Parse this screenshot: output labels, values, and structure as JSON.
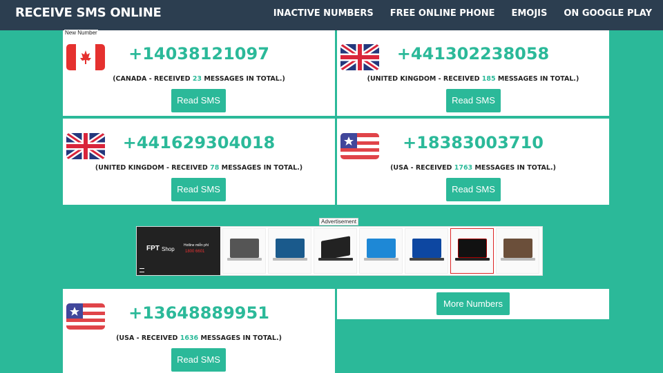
{
  "header": {
    "brand": "RECEIVE SMS ONLINE",
    "nav": [
      "INACTIVE NUMBERS",
      "FREE ONLINE PHONE",
      "EMOJIS",
      "ON GOOGLE PLAY"
    ]
  },
  "new_label": "New Number",
  "cards": [
    {
      "flag": "canada-flag",
      "number": "+14038121097",
      "prefix": "(CANADA - RECEIVED ",
      "count": "23",
      "suffix": " MESSAGES IN TOTAL.)",
      "button": "Read SMS"
    },
    {
      "flag": "uk-flag",
      "number": "+441302238058",
      "prefix": "(UNITED KINGDOM - RECEIVED ",
      "count": "185",
      "suffix": " MESSAGES IN TOTAL.)",
      "button": "Read SMS"
    },
    {
      "flag": "uk-flag",
      "number": "+441629304018",
      "prefix": "(UNITED KINGDOM - RECEIVED ",
      "count": "78",
      "suffix": " MESSAGES IN TOTAL.)",
      "button": "Read SMS"
    },
    {
      "flag": "usa-flag",
      "number": "+18383003710",
      "prefix": "(USA - RECEIVED ",
      "count": "1763",
      "suffix": " MESSAGES IN TOTAL.)",
      "button": "Read SMS"
    },
    {
      "flag": "usa-flag",
      "number": "+13648889951",
      "prefix": "(USA - RECEIVED ",
      "count": "1636",
      "suffix": " MESSAGES IN TOTAL.)",
      "button": "Read SMS"
    }
  ],
  "ad": {
    "label": "Advertisement",
    "banner_brand": "FPT",
    "banner_shop": "Shop",
    "banner_hotline": "Hotline miễn phí",
    "banner_phone": "1800 6601"
  },
  "more_button": "More Numbers"
}
